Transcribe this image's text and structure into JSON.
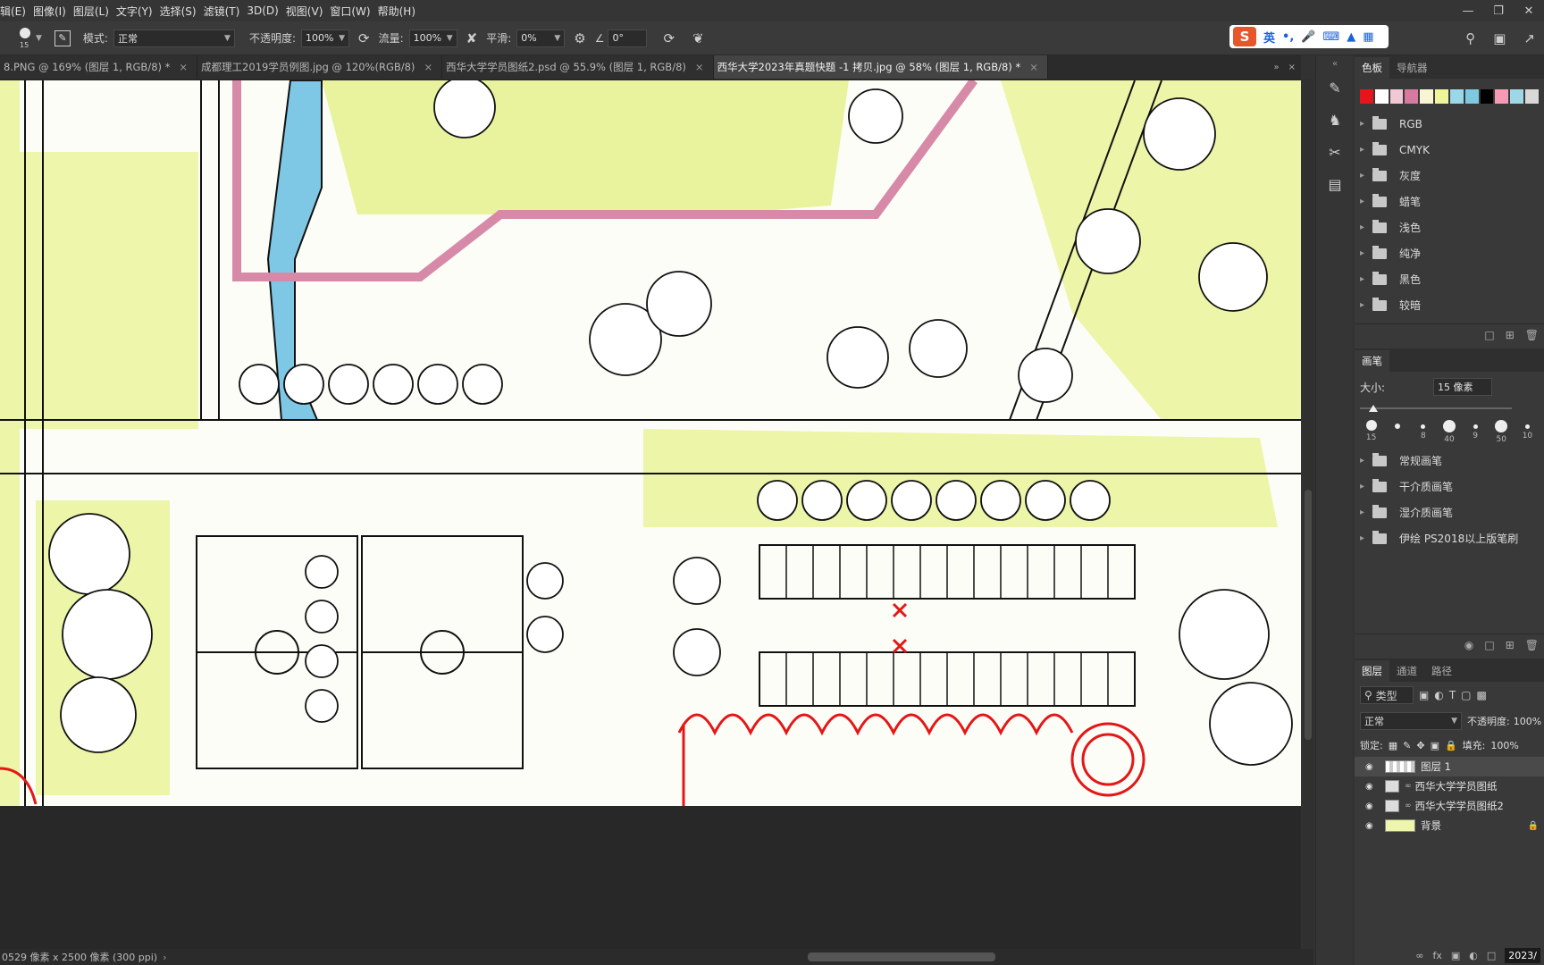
{
  "menu": [
    "辑(E)",
    "图像(I)",
    "图层(L)",
    "文字(Y)",
    "选择(S)",
    "滤镜(T)",
    "3D(D)",
    "视图(V)",
    "窗口(W)",
    "帮助(H)"
  ],
  "options": {
    "brush_size": "15",
    "mode_label": "模式:",
    "mode_value": "正常",
    "opacity_label": "不透明度:",
    "opacity_value": "100%",
    "flow_label": "流量:",
    "flow_value": "100%",
    "smooth_label": "平滑:",
    "smooth_value": "0%",
    "angle_value": "0°"
  },
  "ime": {
    "logo": "S",
    "lang": "英",
    "punct": "•,"
  },
  "tabs": [
    {
      "label": "8.PNG @ 169% (图层 1, RGB/8) *",
      "active": false
    },
    {
      "label": "成都理工2019学员例图.jpg @ 120%(RGB/8)",
      "active": false
    },
    {
      "label": "西华大学学员图纸2.psd @ 55.9% (图层 1, RGB/8)",
      "active": false
    },
    {
      "label": "西华大学2023年真题快题 -1 拷贝.jpg @ 58% (图层 1, RGB/8) *",
      "active": true
    }
  ],
  "status": "0529 像素 x 2500 像素 (300 ppi)",
  "swatches_panel": {
    "tabs": [
      "色板",
      "导航器"
    ],
    "colors": [
      "#e8141c",
      "#ffffff",
      "#f1c8d6",
      "#d87aa0",
      "#f8f4d4",
      "#eef59a",
      "#98d8e8",
      "#7ec8e0",
      "#000000",
      "#f49ab4",
      "#9ed8e6",
      "#d8d8d8"
    ],
    "groups": [
      "RGB",
      "CMYK",
      "灰度",
      "蜡笔",
      "浅色",
      "纯净",
      "黑色",
      "较暗"
    ]
  },
  "brush_panel": {
    "tab": "画笔",
    "size_label": "大小:",
    "size_value": "15 像素",
    "presets": [
      "15",
      "",
      "8",
      "40",
      "9",
      "50",
      "10"
    ],
    "groups": [
      "常规画笔",
      "干介质画笔",
      "湿介质画笔",
      "伊绘 PS2018以上版笔刷"
    ]
  },
  "layers_panel": {
    "tabs": [
      "图层",
      "通道",
      "路径"
    ],
    "kind": "类型",
    "blend": "正常",
    "opacity_label": "不透明度:",
    "opacity_value": "100%",
    "lock_label": "锁定:",
    "fill_label": "填充:",
    "fill_value": "100%",
    "layers": [
      {
        "name": "图层 1",
        "selected": true
      },
      {
        "name": "西华大学学员图纸",
        "selected": false
      },
      {
        "name": "西华大学学员图纸2",
        "selected": false
      },
      {
        "name": "背景",
        "selected": false,
        "locked": true
      }
    ]
  },
  "taskbar_clock": "2023/"
}
